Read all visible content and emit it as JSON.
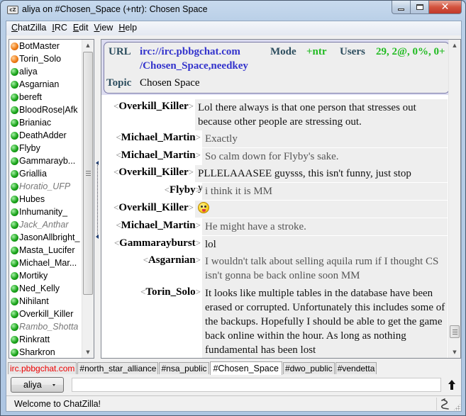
{
  "window": {
    "title": "aliya on #Chosen_Space (+ntr): Chosen Space",
    "app_icon": "chatzilla-icon",
    "app_icon_text": "cZ",
    "buttons": {
      "minimize": "minimize-icon",
      "maximize": "maximize-icon",
      "close": "close-icon",
      "close_glyph": "✕"
    }
  },
  "menubar": {
    "items": [
      {
        "label": "ChatZilla",
        "accel": "C"
      },
      {
        "label": "IRC",
        "accel": "I"
      },
      {
        "label": "Edit",
        "accel": "E"
      },
      {
        "label": "View",
        "accel": "V"
      },
      {
        "label": "Help",
        "accel": "H"
      }
    ]
  },
  "userlist": {
    "users": [
      {
        "name": "BotMaster",
        "status": "op",
        "away": false
      },
      {
        "name": "Torin_Solo",
        "status": "op",
        "away": false
      },
      {
        "name": "aliya",
        "status": "voice",
        "away": false
      },
      {
        "name": "Asgarnian",
        "status": "voice",
        "away": false
      },
      {
        "name": "bereft",
        "status": "voice",
        "away": false
      },
      {
        "name": "BloodRose|Afk",
        "status": "voice",
        "away": false
      },
      {
        "name": "Brianiac",
        "status": "voice",
        "away": false
      },
      {
        "name": "DeathAdder",
        "status": "voice",
        "away": false
      },
      {
        "name": "Flyby",
        "status": "voice",
        "away": false
      },
      {
        "name": "Gammarayb...",
        "status": "voice",
        "away": false
      },
      {
        "name": "Griallia",
        "status": "voice",
        "away": false
      },
      {
        "name": "Horatio_UFP",
        "status": "voice",
        "away": true
      },
      {
        "name": "Hubes",
        "status": "voice",
        "away": false
      },
      {
        "name": "Inhumanity_",
        "status": "voice",
        "away": false
      },
      {
        "name": "Jack_Anthar",
        "status": "voice",
        "away": true
      },
      {
        "name": "JasonAllbright_",
        "status": "voice",
        "away": false
      },
      {
        "name": "Masta_Lucifer",
        "status": "voice",
        "away": false
      },
      {
        "name": "Michael_Mar...",
        "status": "voice",
        "away": false
      },
      {
        "name": "Mortiky",
        "status": "voice",
        "away": false
      },
      {
        "name": "Ned_Kelly",
        "status": "voice",
        "away": false
      },
      {
        "name": "Nihilant",
        "status": "voice",
        "away": false
      },
      {
        "name": "Overkill_Killer",
        "status": "voice",
        "away": false
      },
      {
        "name": "Rambo_Shotta",
        "status": "voice",
        "away": true
      },
      {
        "name": "Rinkratt",
        "status": "voice",
        "away": false
      },
      {
        "name": "Sharkron",
        "status": "voice",
        "away": false
      }
    ]
  },
  "channel_header": {
    "url_label": "URL",
    "url_line1": "irc://irc.pbbgchat.com",
    "url_line2": "/Chosen_Space,needkey",
    "mode_label": "Mode",
    "mode_value": "+ntr",
    "users_label": "Users",
    "users_value": "29, 2@, 0%, 0+",
    "topic_label": "Topic",
    "topic_value": "Chosen Space"
  },
  "messages": [
    {
      "nick": "Overkill_Killer",
      "text": "Lol there always is that one person that stresses out because other people are stressing out.",
      "style": "dark"
    },
    {
      "nick": "Michael_Martin",
      "text": "Exactly",
      "style": "dim"
    },
    {
      "nick": "Michael_Martin",
      "text": "So calm down for Flyby's sake.",
      "style": "dim"
    },
    {
      "nick": "Overkill_Killer",
      "text": "PLLELAAASEE guysss, this isn't funny, just stop yelling.",
      "style": "dark"
    },
    {
      "nick": "Flyby",
      "text": "i think it is MM",
      "style": "dim"
    },
    {
      "nick": "Overkill_Killer",
      "text": "",
      "emoji": "tongue-out-emoji",
      "style": "dark"
    },
    {
      "nick": "Michael_Martin",
      "text": "He might have a stroke.",
      "style": "dim"
    },
    {
      "nick": "Gammarayburst",
      "text": "lol",
      "style": "dark"
    },
    {
      "nick": "Asgarnian",
      "text": "I wouldn't talk about selling aquila rum if I thought CS isn't gonna be back online soon MM",
      "style": "dim"
    },
    {
      "nick": "Torin_Solo",
      "text": "It looks like multiple tables in the database have been erased or corrupted. Unfortunately this includes some of the backups. Hopefully I should be able to get the game back online within the hour. As long as nothing fundamental has been lost",
      "style": "dark"
    }
  ],
  "tabs": [
    {
      "label": "irc.pbbgchat.com",
      "type": "server",
      "active": false
    },
    {
      "label": "#north_star_alliance",
      "type": "channel",
      "active": false
    },
    {
      "label": "#nsa_public",
      "type": "channel",
      "active": false
    },
    {
      "label": "#Chosen_Space",
      "type": "channel",
      "active": true
    },
    {
      "label": "#dwo_public",
      "type": "channel",
      "active": false
    },
    {
      "label": "#vendetta",
      "type": "channel",
      "active": false
    }
  ],
  "input": {
    "nick": "aliya",
    "value": "",
    "placeholder": ""
  },
  "status": {
    "text": "Welcome to ChatZilla!"
  },
  "colors": {
    "op_dot": "#f07d16",
    "voice_dot": "#1aa41a",
    "url": "#3333cc",
    "mode": "#22bb22",
    "header_label": "#2c4d5e",
    "server_tab": "#ee0000"
  }
}
